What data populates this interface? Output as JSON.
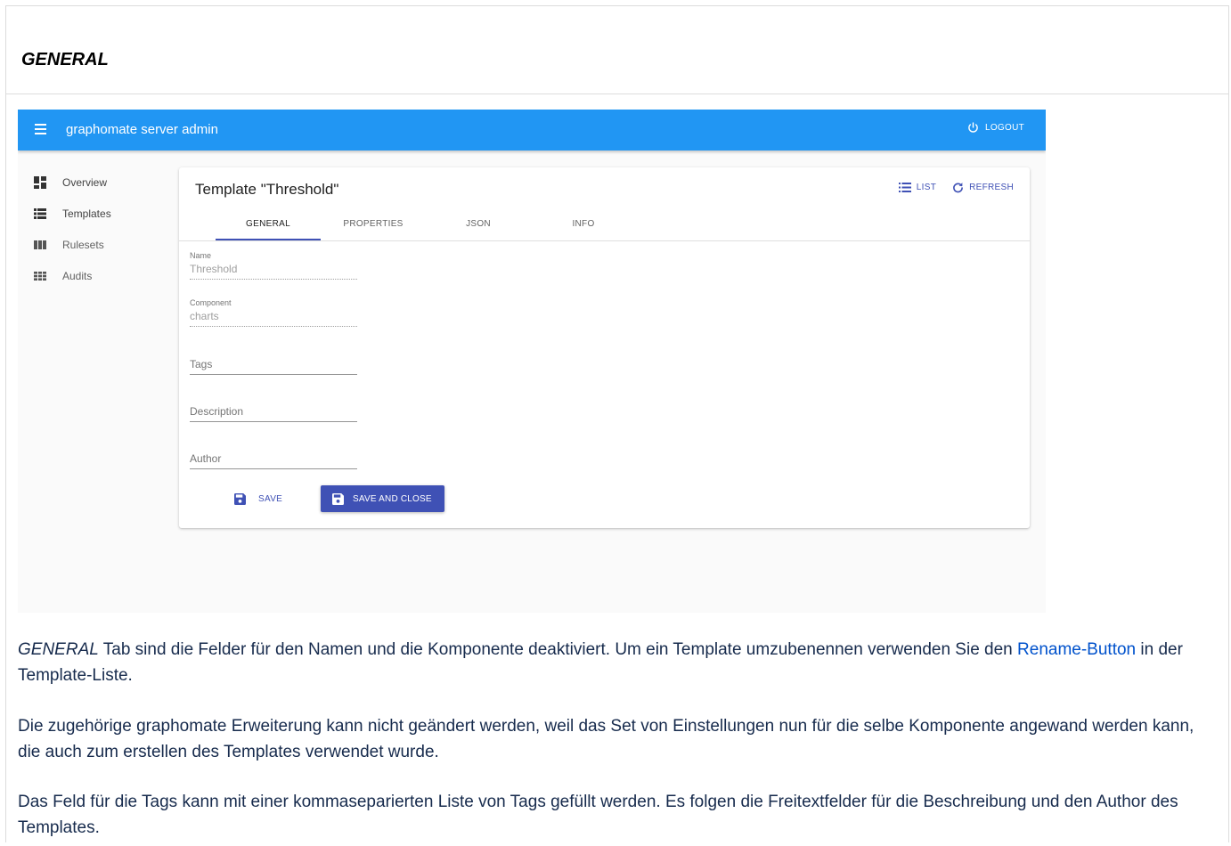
{
  "section": {
    "title": "GENERAL"
  },
  "app": {
    "title": "graphomate server admin",
    "logout_label": "LOGOUT",
    "colors": {
      "appbar": "#2196f3",
      "primary": "#3f51b5"
    }
  },
  "sidebar": {
    "items": [
      {
        "label": "Overview",
        "icon": "dashboard-icon"
      },
      {
        "label": "Templates",
        "icon": "list-icon"
      },
      {
        "label": "Rulesets",
        "icon": "columns-icon"
      },
      {
        "label": "Audits",
        "icon": "grid-icon"
      }
    ]
  },
  "card": {
    "title": "Template \"Threshold\"",
    "actions": {
      "list": "LIST",
      "refresh": "REFRESH"
    },
    "tabs": [
      {
        "label": "GENERAL",
        "active": true
      },
      {
        "label": "PROPERTIES"
      },
      {
        "label": "JSON"
      },
      {
        "label": "INFO"
      }
    ],
    "fields": {
      "name": {
        "label": "Name",
        "value": "Threshold",
        "disabled": true
      },
      "component": {
        "label": "Component",
        "value": "charts",
        "disabled": true
      },
      "tags": {
        "placeholder": "Tags"
      },
      "description": {
        "placeholder": "Description"
      },
      "author": {
        "placeholder": "Author"
      }
    },
    "buttons": {
      "save": "SAVE",
      "save_and_close": "SAVE AND CLOSE"
    }
  },
  "paragraphs": {
    "p1": {
      "prefix_em": "GENERAL",
      "text_before_link": " Tab sind die Felder für den Namen und die Komponente deaktiviert. Um ein Template umzubenennen verwenden Sie den ",
      "link": "Rename-Button",
      "text_after_link": " in der Template-Liste."
    },
    "p2": "Die zugehörige graphomate Erweiterung kann nicht geändert werden, weil das Set von Einstellungen nun für die selbe Komponente angewand werden kann, die auch zum erstellen des Templates verwendet wurde.",
    "p3": "Das Feld für die Tags kann mit einer kommaseparierten Liste von Tags gefüllt werden. Es folgen die Freitextfelder für die Beschreibung und den Author des Templates."
  }
}
